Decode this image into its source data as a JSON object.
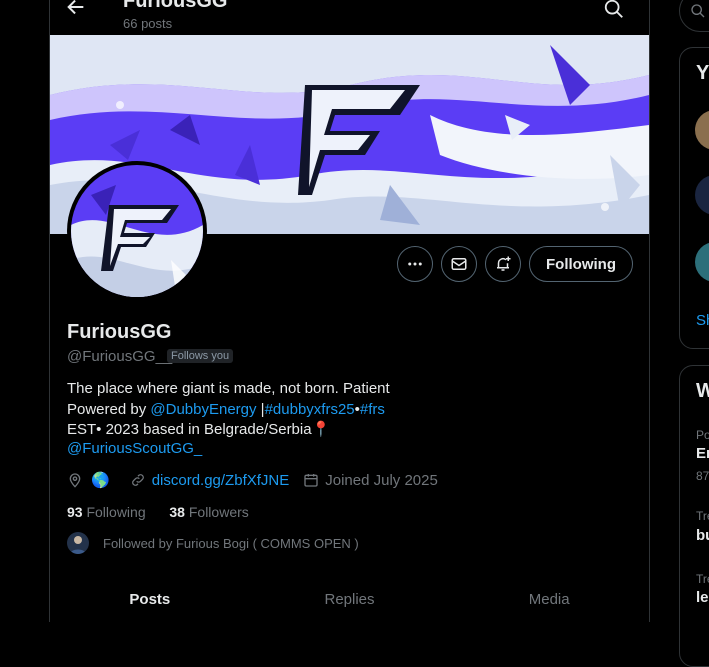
{
  "header": {
    "back_icon": "arrow-left-icon",
    "title": "FuriousGG",
    "post_count": "66 posts",
    "search_icon": "search-icon"
  },
  "profile": {
    "display_name": "FuriousGG",
    "handle": "@FuriousGG__",
    "follows_you_badge": "Follows you",
    "bio_line1": "The place where giant is made, not born. Patient",
    "bio_line2_prefix": "Powered by ",
    "bio_line2_mention": "@DubbyEnergy",
    "bio_line2_sep": " |",
    "bio_line2_hashtag1": "#dubbyxfrs25",
    "bio_line2_bullet": "•",
    "bio_line2_hashtag2": "#frs",
    "bio_line3": "EST• 2023 based in Belgrade/Serbia📍",
    "bio_line4_mention": "@FuriousScoutGG_",
    "location_emoji": "🌎",
    "website": "discord.gg/ZbfXfJNE",
    "joined": "Joined July 2025",
    "following_count": "93",
    "following_label": "Following",
    "followers_count": "38",
    "followers_label": "Followers",
    "followed_by": "Followed by Furious Bogi ( COMMS OPEN )"
  },
  "actions": {
    "more_icon": "more-icon",
    "message_icon": "mail-icon",
    "notify_icon": "bell-plus-icon",
    "following_button": "Following"
  },
  "tabs": [
    "Posts",
    "Replies",
    "Media"
  ],
  "active_tab": "Posts",
  "sidebar": {
    "card1_heading_partial": "Y",
    "card1_show_more_partial": "Sh",
    "card2_heading_partial": "W",
    "trend1_label": "Po",
    "trend1_title": "En",
    "trend1_count": "87",
    "trend2_label": "Tre",
    "trend2_title": "bu",
    "trend3_label": "Tre",
    "trend3_title": "le"
  },
  "colors": {
    "accent": "#1d9bf0",
    "brand_purple": "#5b3df5",
    "background": "#000000",
    "muted": "#71767b"
  }
}
